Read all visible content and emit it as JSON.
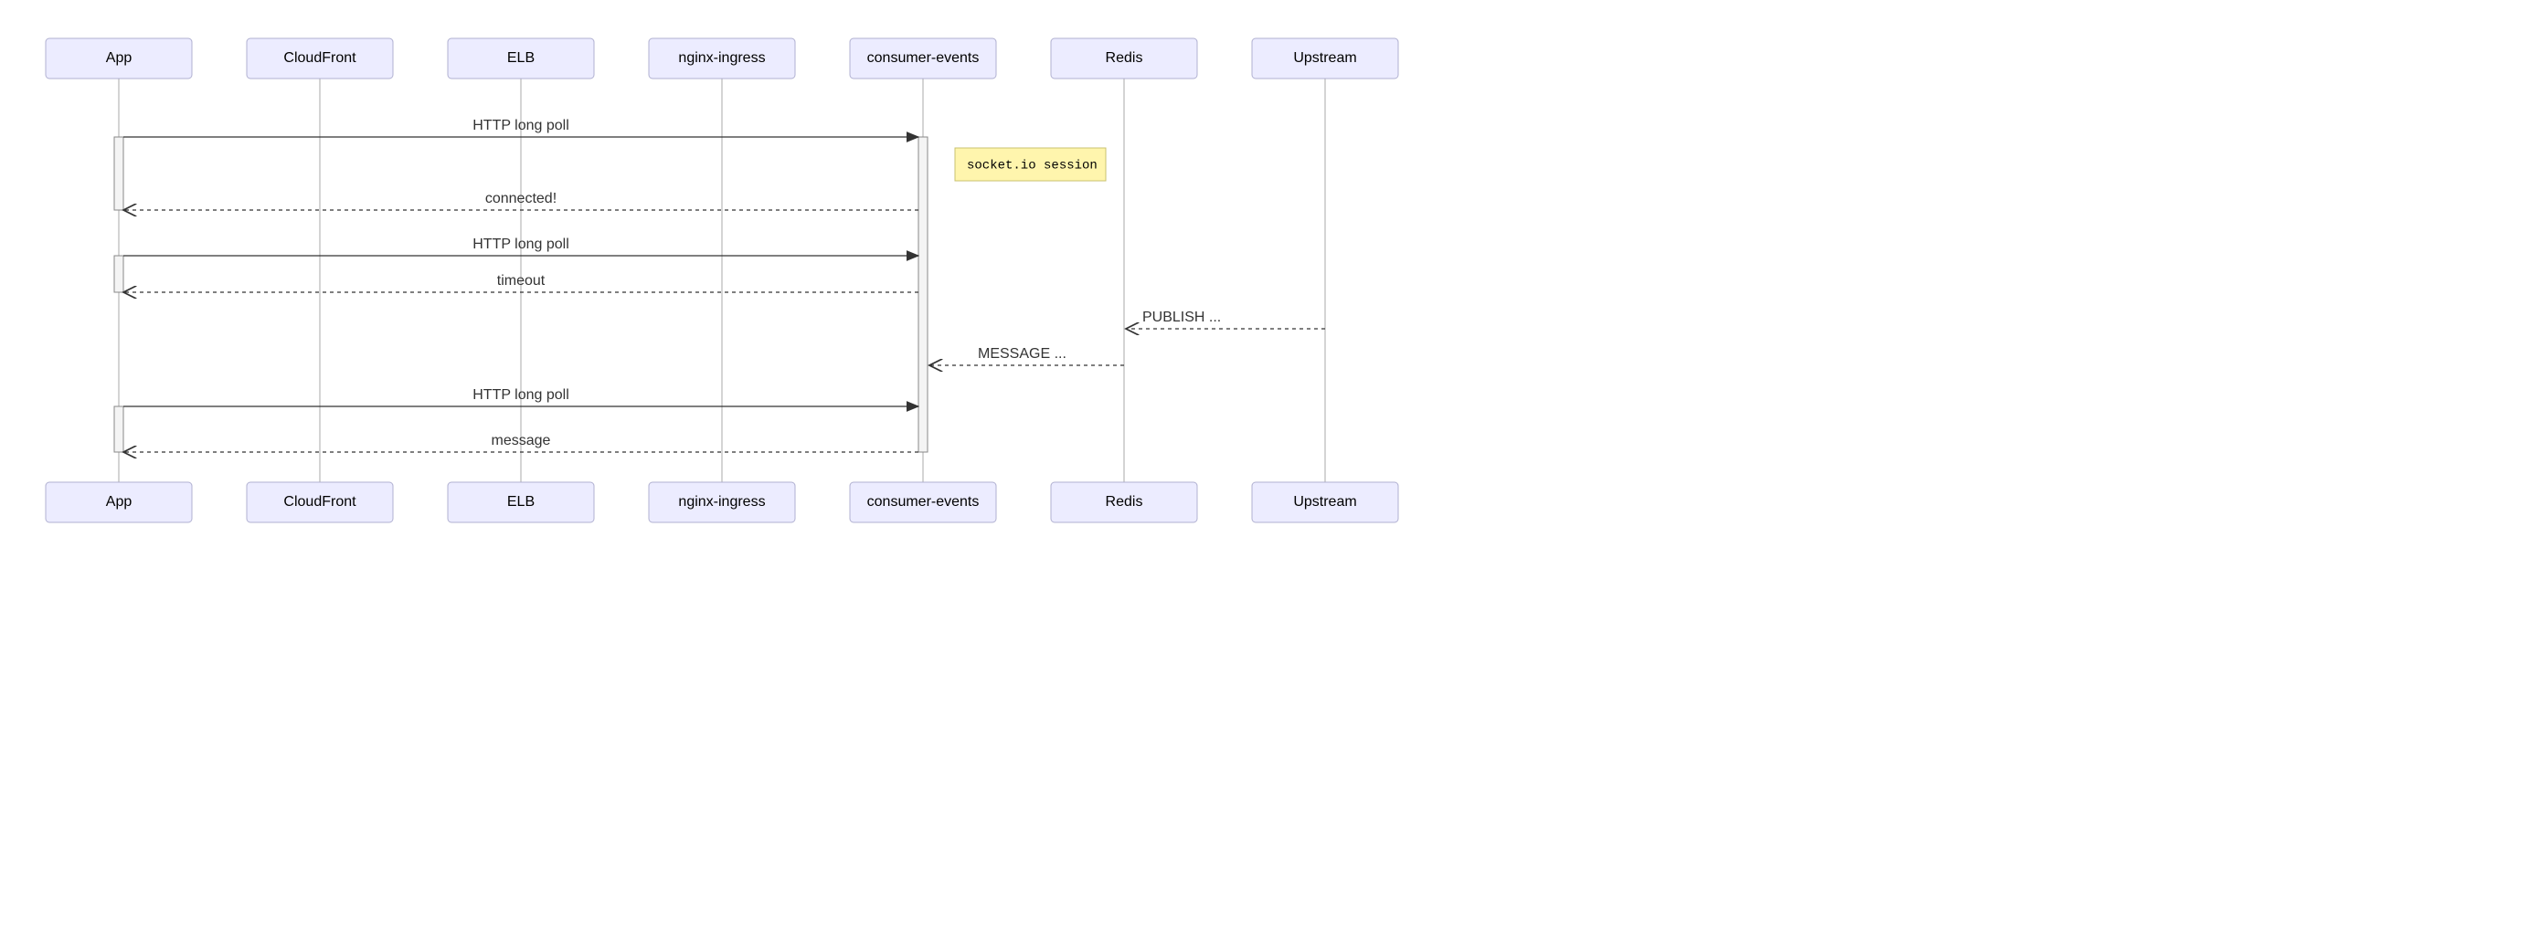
{
  "participants": [
    "App",
    "CloudFront",
    "ELB",
    "nginx-ingress",
    "consumer-events",
    "Redis",
    "Upstream"
  ],
  "note": "socket.io session",
  "messages": {
    "m1": "HTTP long poll",
    "m2": "connected!",
    "m3": "HTTP long poll",
    "m4": "timeout",
    "m5": "PUBLISH ...",
    "m6": "MESSAGE ...",
    "m7": "HTTP long poll",
    "m8": "message"
  },
  "chart_data": {
    "type": "sequence-diagram",
    "participants": [
      "App",
      "CloudFront",
      "ELB",
      "nginx-ingress",
      "consumer-events",
      "Redis",
      "Upstream"
    ],
    "events": [
      {
        "from": "App",
        "to": "consumer-events",
        "label": "HTTP long poll",
        "style": "solid",
        "direction": "right"
      },
      {
        "note_over": "consumer-events",
        "text": "socket.io session"
      },
      {
        "from": "consumer-events",
        "to": "App",
        "label": "connected!",
        "style": "dashed",
        "direction": "left"
      },
      {
        "from": "App",
        "to": "consumer-events",
        "label": "HTTP long poll",
        "style": "solid",
        "direction": "right"
      },
      {
        "from": "consumer-events",
        "to": "App",
        "label": "timeout",
        "style": "dashed",
        "direction": "left"
      },
      {
        "from": "Upstream",
        "to": "Redis",
        "label": "PUBLISH ...",
        "style": "dashed",
        "direction": "left"
      },
      {
        "from": "Redis",
        "to": "consumer-events",
        "label": "MESSAGE ...",
        "style": "dashed",
        "direction": "left"
      },
      {
        "from": "App",
        "to": "consumer-events",
        "label": "HTTP long poll",
        "style": "solid",
        "direction": "right"
      },
      {
        "from": "consumer-events",
        "to": "App",
        "label": "message",
        "style": "dashed",
        "direction": "left"
      }
    ],
    "activations": [
      {
        "participant": "App",
        "span": "m1-m2"
      },
      {
        "participant": "App",
        "span": "m3-m4"
      },
      {
        "participant": "App",
        "span": "m7-m8"
      },
      {
        "participant": "consumer-events",
        "span": "m1-m8"
      }
    ]
  }
}
